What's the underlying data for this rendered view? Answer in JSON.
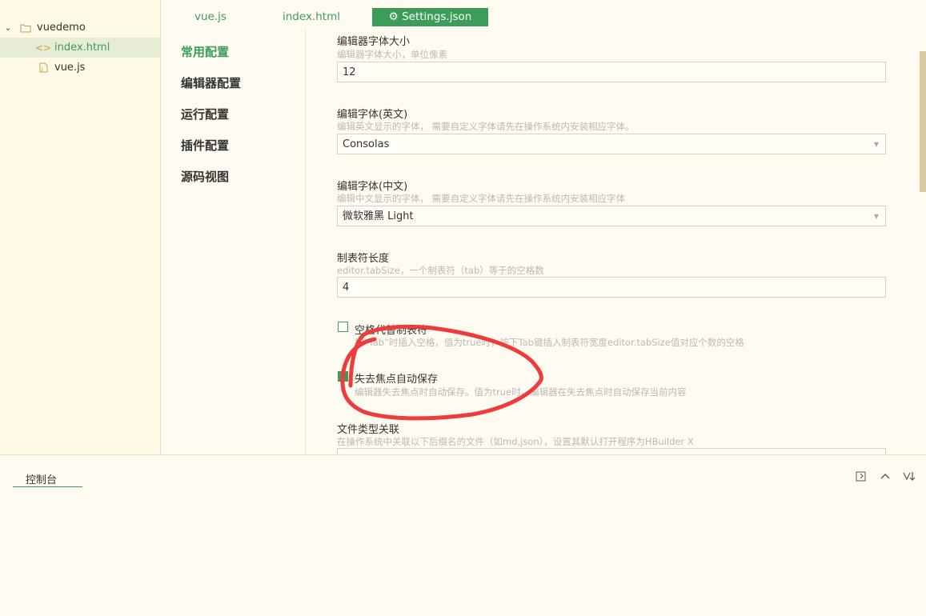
{
  "sidebar": {
    "project": {
      "name": "vuedemo",
      "icon": "folder-icon"
    },
    "files": [
      {
        "name": "index.html",
        "icon": "html-file-icon",
        "selected": true
      },
      {
        "name": "vue.js",
        "icon": "js-file-icon",
        "selected": false
      }
    ]
  },
  "tabs": [
    {
      "label": "vue.js"
    },
    {
      "label": "index.html"
    },
    {
      "label": "Settings.json",
      "icon": "gear-icon",
      "active": true
    }
  ],
  "settings_nav": [
    {
      "label": "常用配置",
      "active": true
    },
    {
      "label": "编辑器配置"
    },
    {
      "label": "运行配置"
    },
    {
      "label": "插件配置"
    },
    {
      "label": "源码视图"
    }
  ],
  "settings": {
    "font_size": {
      "label": "编辑器字体大小",
      "desc": "编辑器字体大小，单位像素",
      "value": "12"
    },
    "font_en": {
      "label": "编辑字体(英文)",
      "desc": "编辑英文显示的字体， 需要自定义字体请先在操作系统内安装相应字体。",
      "value": "Consolas"
    },
    "font_cn": {
      "label": "编辑字体(中文)",
      "desc": "编辑中文显示的字体， 需要自定义字体请先在操作系统内安装相应字体",
      "value": "微软雅黑 Light"
    },
    "tab_size": {
      "label": "制表符长度",
      "desc": "editor.tabSize，一个制表符（tab）等于的空格数",
      "value": "4"
    },
    "insert_spaces": {
      "label": "空格代替制表符",
      "desc": "按“Tab”时插入空格，值为true时，按下Tab键插入制表符宽度editor.tabSize值对应个数的空格",
      "checked": false
    },
    "auto_save": {
      "label": "失去焦点自动保存",
      "desc": "编辑器失去焦点时自动保存。值为true时，编辑器在失去焦点时自动保存当前内容",
      "checked": true
    },
    "file_assoc": {
      "label": "文件类型关联",
      "desc": "在操作系统中关联以下后缀名的文件（如md,json），设置其默认打开程序为HBuilder X"
    }
  },
  "console": {
    "tab_label": "控制台",
    "icons": [
      "open-external-icon",
      "chevron-up-icon",
      "sort-down-icon"
    ]
  },
  "colors": {
    "accent": "#3c9c5a",
    "background": "#fffbf0",
    "annotation": "#ee3b3b"
  }
}
